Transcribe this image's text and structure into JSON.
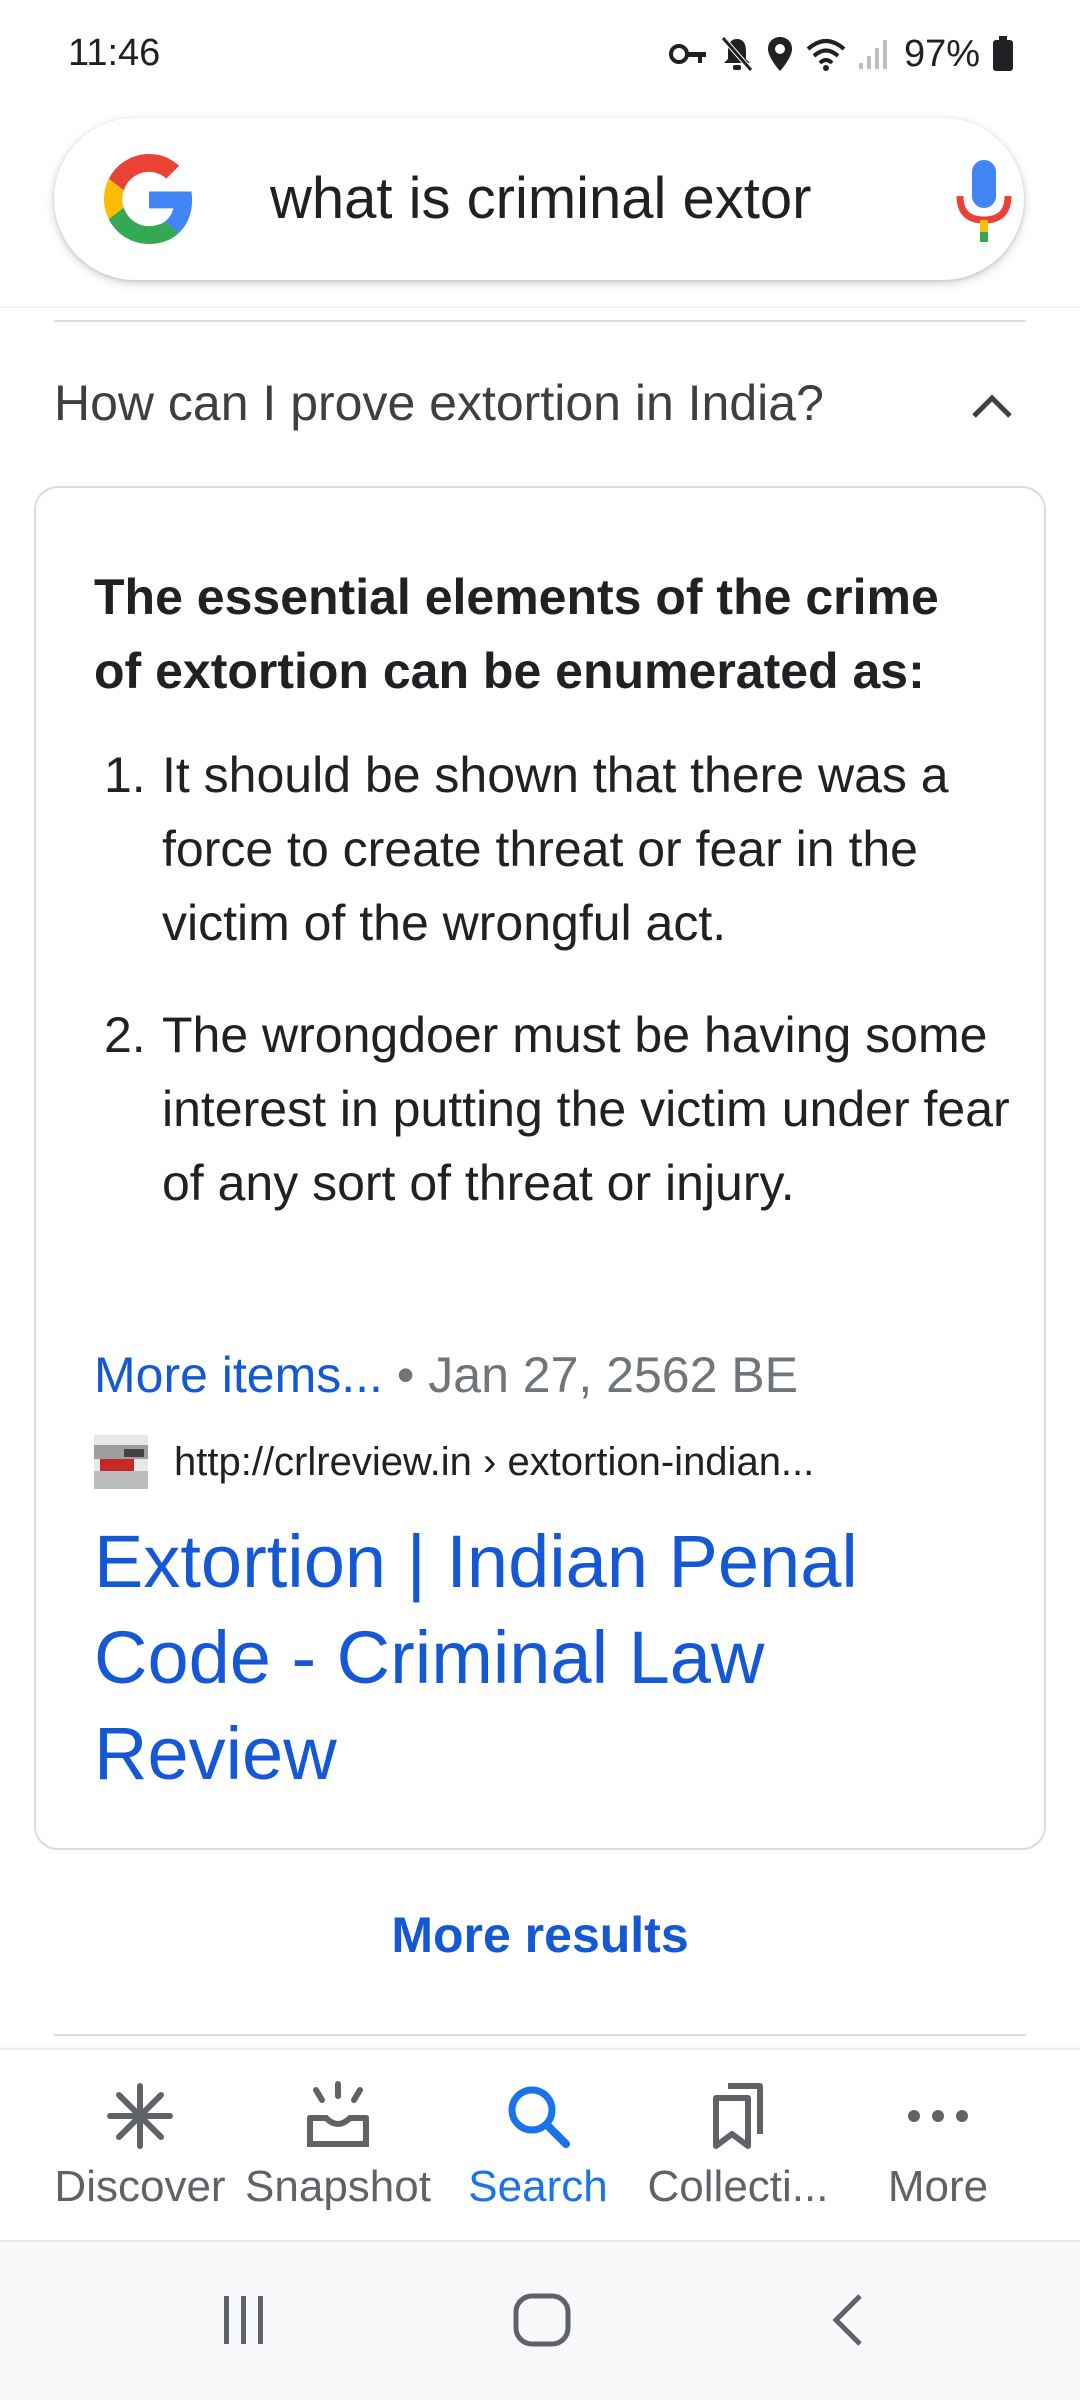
{
  "status_bar": {
    "time": "11:46",
    "battery": "97%"
  },
  "search": {
    "query": "what is criminal extor"
  },
  "question": {
    "text": "How can I prove extortion in India?",
    "expanded": true
  },
  "answer": {
    "heading": "The essential elements of the crime of extortion can be enumerated as:",
    "items": [
      {
        "number": "1.",
        "text": "It should be shown that there was a force to create threat or fear in the victim of the wrongful act."
      },
      {
        "number": "2.",
        "text": "The wrongdoer must be having some interest in putting the victim under fear of any sort of threat or injury."
      }
    ],
    "more_items_label": "More items...",
    "separator": "•",
    "date": "Jan 27, 2562 BE",
    "source_url": "http://crlreview.in › extortion-indian...",
    "result_title": "Extortion | Indian Penal Code - Criminal Law Review"
  },
  "more_results_label": "More results",
  "bottom_nav": {
    "items": [
      {
        "label": "Discover",
        "icon": "asterisk-icon",
        "active": false
      },
      {
        "label": "Snapshot",
        "icon": "snapshot-icon",
        "active": false
      },
      {
        "label": "Search",
        "icon": "search-icon",
        "active": true
      },
      {
        "label": "Collecti...",
        "icon": "bookmarks-icon",
        "active": false
      },
      {
        "label": "More",
        "icon": "more-dots-icon",
        "active": false
      }
    ]
  },
  "colors": {
    "link_blue": "#1558d6",
    "active_blue": "#1a73e8",
    "text_dark": "#202124",
    "text_gray": "#70757a"
  }
}
